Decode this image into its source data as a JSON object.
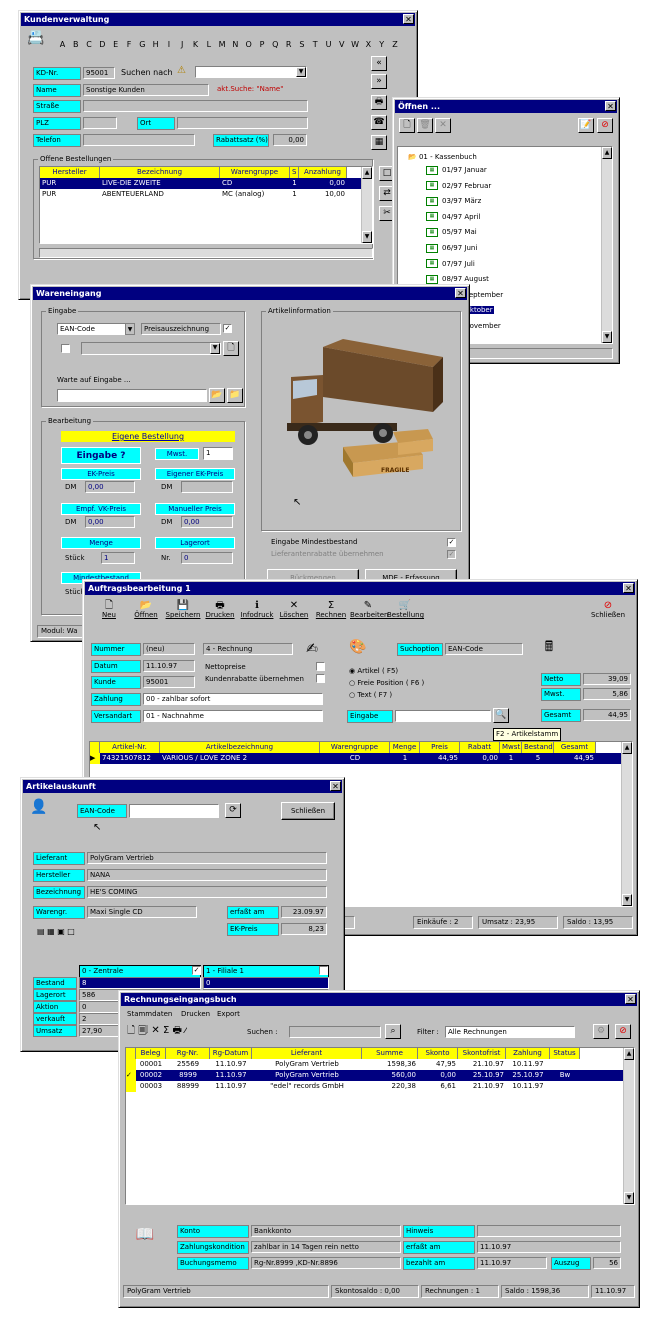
{
  "kv": {
    "title": "Kundenverwaltung",
    "letters": [
      "A",
      "B",
      "C",
      "D",
      "E",
      "F",
      "G",
      "H",
      "I",
      "J",
      "K",
      "L",
      "M",
      "N",
      "O",
      "P",
      "Q",
      "R",
      "S",
      "T",
      "U",
      "V",
      "W",
      "X",
      "Y",
      "Z"
    ],
    "kdnr_label": "KD-Nr.",
    "kdnr": "95001",
    "suchen_label": "Suchen nach",
    "akt": "akt.Suche: \"Name\"",
    "name_label": "Name",
    "name": "Sonstige Kunden",
    "strasse_label": "Straße",
    "plz_label": "PLZ",
    "ort_label": "Ort",
    "telefon_label": "Telefon",
    "rabatt_label": "Rabattsatz (%)",
    "rabatt": "0,00",
    "offene": "Offene Bestellungen",
    "headers": [
      "Hersteller",
      "Bezeichnung",
      "Warengruppe",
      "S",
      "Anzahlung"
    ],
    "rows": [
      [
        "PUR",
        "LIVE-DIE ZWEITE",
        "CD",
        "1",
        "0,00"
      ],
      [
        "PUR",
        "ABENTEUERLAND",
        "MC (analog)",
        "1",
        "10,00"
      ]
    ]
  },
  "of": {
    "title": "Öffnen ...",
    "root": "01 - Kassenbuch",
    "items": [
      "01/97 Januar",
      "02/97 Februar",
      "03/97 März",
      "04/97 April",
      "05/97 Mai",
      "06/97 Juni",
      "07/97 Juli",
      "08/97 August",
      "09/97 September",
      "10/97 Oktober",
      "11/97 November"
    ]
  },
  "we": {
    "title": "Wareneingang",
    "eingabe": "Eingabe",
    "ean": "EAN-Code",
    "preis": "Preisauszeichnung",
    "warte": "Warte auf Eingabe ...",
    "bearbeitung": "Bearbeitung",
    "eigene": "Eigene Bestellung",
    "eingabe_q": "Eingabe ?",
    "mwst": "Mwst.",
    "mwst_val": "1",
    "ek": "EK-Preis",
    "eek": "Eigener EK-Preis",
    "dm": "DM",
    "v000": "0,00",
    "vk": "Empf. VK-Preis",
    "mp": "Manueller Preis",
    "menge": "Menge",
    "lagerort": "Lagerort",
    "stueck": "Stück",
    "nr": "Nr.",
    "one": "1",
    "zero": "0",
    "mind": "Mindestbestand",
    "artinfo": "Artikelinformation",
    "crate": "FRAGILE",
    "eing_mind": "Eingabe Mindestbestand",
    "lief": "Lieferantenrabatte übernehmen",
    "btn1": "Rückmengen",
    "btn2": "MDE - Erfassung",
    "modul": "Modul: Wa"
  },
  "ab": {
    "title": "Auftragsbearbeitung 1",
    "tools": [
      "Neu",
      "Öffnen",
      "Speichern",
      "Drucken",
      "Infodruck",
      "Löschen",
      "Rechnen",
      "Bearbeiten",
      "Bestellung"
    ],
    "schliessen": "Schließen",
    "nummer_l": "Nummer",
    "nummer": "(neu)",
    "rechnung": "4 - Rechnung",
    "datum_l": "Datum",
    "datum": "11.10.97",
    "netto_p": "Nettopreise",
    "kunde_l": "Kunde",
    "kunde": "95001",
    "kr": "Kundenrabatte übernehmen",
    "zahlung_l": "Zahlung",
    "zahlung": "00 - zahlbar sofort",
    "versand_l": "Versandart",
    "versand": "01 - Nachnahme",
    "suchopt": "Suchoption",
    "suchval": "EAN-Code",
    "r1": "Artikel ( F5)",
    "r2": "Freie Position ( F6 )",
    "r3": "Text ( F7 )",
    "eingabe": "Eingabe",
    "f2": "F2 - Artikelstamm",
    "netto_l": "Netto",
    "netto": "39,09",
    "mwst_l": "Mwst.",
    "mwst": "5,86",
    "gesamt_l": "Gesamt",
    "gesamt": "44,95",
    "headers": [
      "Artikel-Nr.",
      "Artikelbezeichnung",
      "Warengruppe",
      "Menge",
      "Preis",
      "Rabatt",
      "Mwst.",
      "Bestand",
      "Gesamt"
    ],
    "row": [
      "74321507812",
      "VARIOUS / LOVE ZONE 2",
      "CD",
      "1",
      "44,95",
      "0,00",
      "1",
      "5",
      "44,95"
    ],
    "status": [
      "abatt : 0,00",
      "Einkäufe : 2",
      "Umsatz : 23,95",
      "Saldo : 13,95"
    ]
  },
  "aa": {
    "title": "Artikelauskunft",
    "ean": "EAN-Code",
    "schliessen": "Schließen",
    "lief_l": "Lieferant",
    "lief": "PolyGram Vertrieb",
    "herst_l": "Hersteller",
    "herst": "NANA",
    "bez_l": "Bezeichnung",
    "bez": "HE'S COMING",
    "wg_l": "Warengr.",
    "wg": "Maxi Single CD",
    "erf_l": "erfaßt am",
    "erf": "23.09.97",
    "ek_l": "EK-Preis",
    "ek": "8,23",
    "zentrale": "0 - Zentrale",
    "filiale": "1 - Filiale 1",
    "rows": [
      [
        "Bestand",
        "8",
        "0"
      ],
      [
        "Lagerort",
        "586",
        ""
      ],
      [
        "Aktion",
        "0",
        ""
      ],
      [
        "verkauft",
        "2",
        ""
      ],
      [
        "Umsatz",
        "27,90",
        ""
      ]
    ]
  },
  "re": {
    "title": "Rechnungseingangsbuch",
    "menu": [
      "Stammdaten",
      "Drucken",
      "Export"
    ],
    "suchen": "Suchen :",
    "filter": "Filter :",
    "filter_val": "Alle Rechnungen",
    "headers": [
      "Beleg",
      "Rg-Nr.",
      "Rg-Datum",
      "Lieferant",
      "Summe",
      "Skonto",
      "Skontofrist",
      "Zahlung",
      "Status"
    ],
    "rows": [
      [
        "00001",
        "25569",
        "11.10.97",
        "PolyGram Vertrieb",
        "1598,36",
        "47,95",
        "21.10.97",
        "10.11.97",
        ""
      ],
      [
        "00002",
        "8999",
        "11.10.97",
        "PolyGram Vertrieb",
        "560,00",
        "0,00",
        "25.10.97",
        "25.10.97",
        "Bw"
      ],
      [
        "00003",
        "88999",
        "11.10.97",
        "\"edel\" records GmbH",
        "220,38",
        "6,61",
        "21.10.97",
        "10.11.97",
        ""
      ]
    ],
    "konto_l": "Konto",
    "konto": "Bankkonto",
    "zk_l": "Zahlungskondition",
    "zk": "zahlbar in 14 Tagen rein netto",
    "bm_l": "Buchungsmemo",
    "bm": "Rg-Nr.8999 ,KD-Nr.8896",
    "hinweis_l": "Hinweis",
    "erf_l": "erfaßt am",
    "erf": "11.10.97",
    "bez_l": "bezahlt am",
    "bez": "11.10.97",
    "auszug_l": "Auszug",
    "auszug": "56",
    "status": [
      "PolyGram Vertrieb",
      "Skontosaldo : 0,00",
      "Rechnungen : 1",
      "Saldo : 1598,36",
      "11.10.97"
    ]
  }
}
